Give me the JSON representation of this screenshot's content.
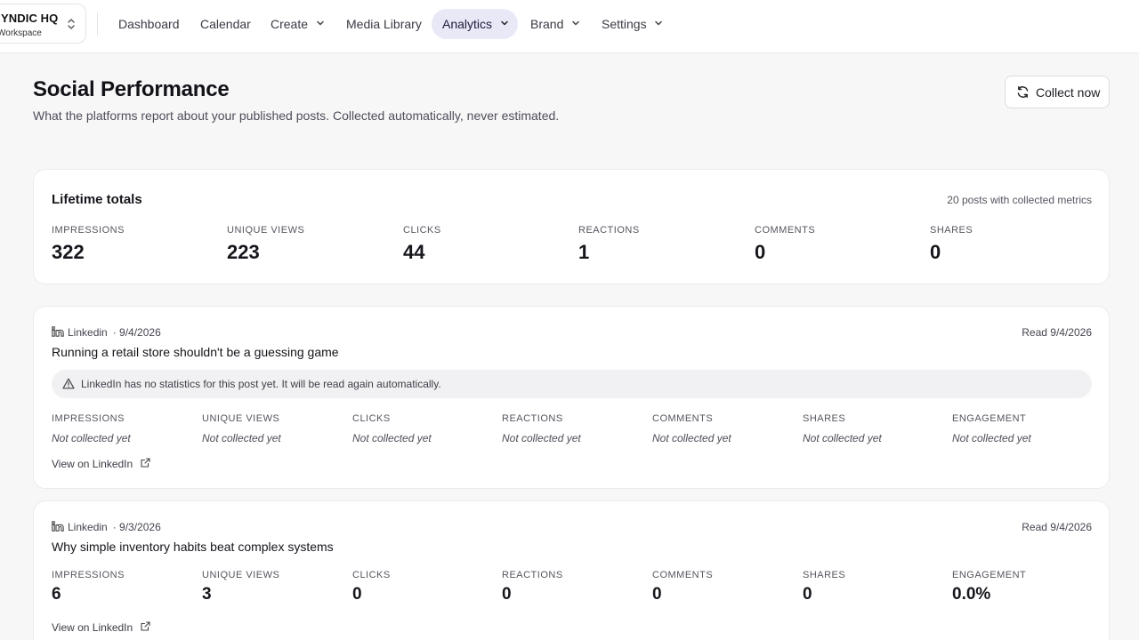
{
  "workspace": {
    "name": "YNDIC HQ",
    "subtitle": "Workspace"
  },
  "nav": {
    "items": [
      {
        "label": "Dashboard"
      },
      {
        "label": "Calendar"
      },
      {
        "label": "Create"
      },
      {
        "label": "Media Library"
      },
      {
        "label": "Analytics"
      },
      {
        "label": "Brand"
      },
      {
        "label": "Settings"
      }
    ],
    "active": "Analytics"
  },
  "header": {
    "title": "Social Performance",
    "subtitle": "What the platforms report about your published posts. Collected automatically, never estimated.",
    "collect_label": "Collect now"
  },
  "totals": {
    "title": "Lifetime totals",
    "meta": "20 posts with collected metrics",
    "metrics": [
      {
        "label": "Impressions",
        "value": "322"
      },
      {
        "label": "Unique views",
        "value": "223"
      },
      {
        "label": "Clicks",
        "value": "44"
      },
      {
        "label": "Reactions",
        "value": "1"
      },
      {
        "label": "Comments",
        "value": "0"
      },
      {
        "label": "Shares",
        "value": "0"
      }
    ]
  },
  "posts": [
    {
      "platform": "Linkedin",
      "date": "· 9/4/2026",
      "read": "Read 9/4/2026",
      "title": "Running a retail store shouldn't be a guessing game",
      "notice": "LinkedIn has no statistics for this post yet. It will be read again automatically.",
      "metrics": [
        {
          "label": "Impressions",
          "value": "Not collected yet"
        },
        {
          "label": "Unique views",
          "value": "Not collected yet"
        },
        {
          "label": "Clicks",
          "value": "Not collected yet"
        },
        {
          "label": "Reactions",
          "value": "Not collected yet"
        },
        {
          "label": "Comments",
          "value": "Not collected yet"
        },
        {
          "label": "Shares",
          "value": "Not collected yet"
        },
        {
          "label": "Engagement",
          "value": "Not collected yet"
        }
      ],
      "link": "View on LinkedIn"
    },
    {
      "platform": "Linkedin",
      "date": "· 9/3/2026",
      "read": "Read 9/4/2026",
      "title": "Why simple inventory habits beat complex systems",
      "metrics": [
        {
          "label": "Impressions",
          "value": "6"
        },
        {
          "label": "Unique views",
          "value": "3"
        },
        {
          "label": "Clicks",
          "value": "0"
        },
        {
          "label": "Reactions",
          "value": "0"
        },
        {
          "label": "Comments",
          "value": "0"
        },
        {
          "label": "Shares",
          "value": "0"
        },
        {
          "label": "Engagement",
          "value": "0.0%"
        }
      ],
      "link": "View on LinkedIn"
    }
  ],
  "icons": {
    "switcher": "chevrons-up-down-icon",
    "dropdown": "chevron-down-icon",
    "refresh": "refresh-icon",
    "linkedin": "linkedin-icon",
    "warning": "warning-triangle-icon",
    "external": "external-link-icon"
  },
  "colors": {
    "accent_bg": "#e9e8f7",
    "page_bg": "#f7f7f8"
  }
}
